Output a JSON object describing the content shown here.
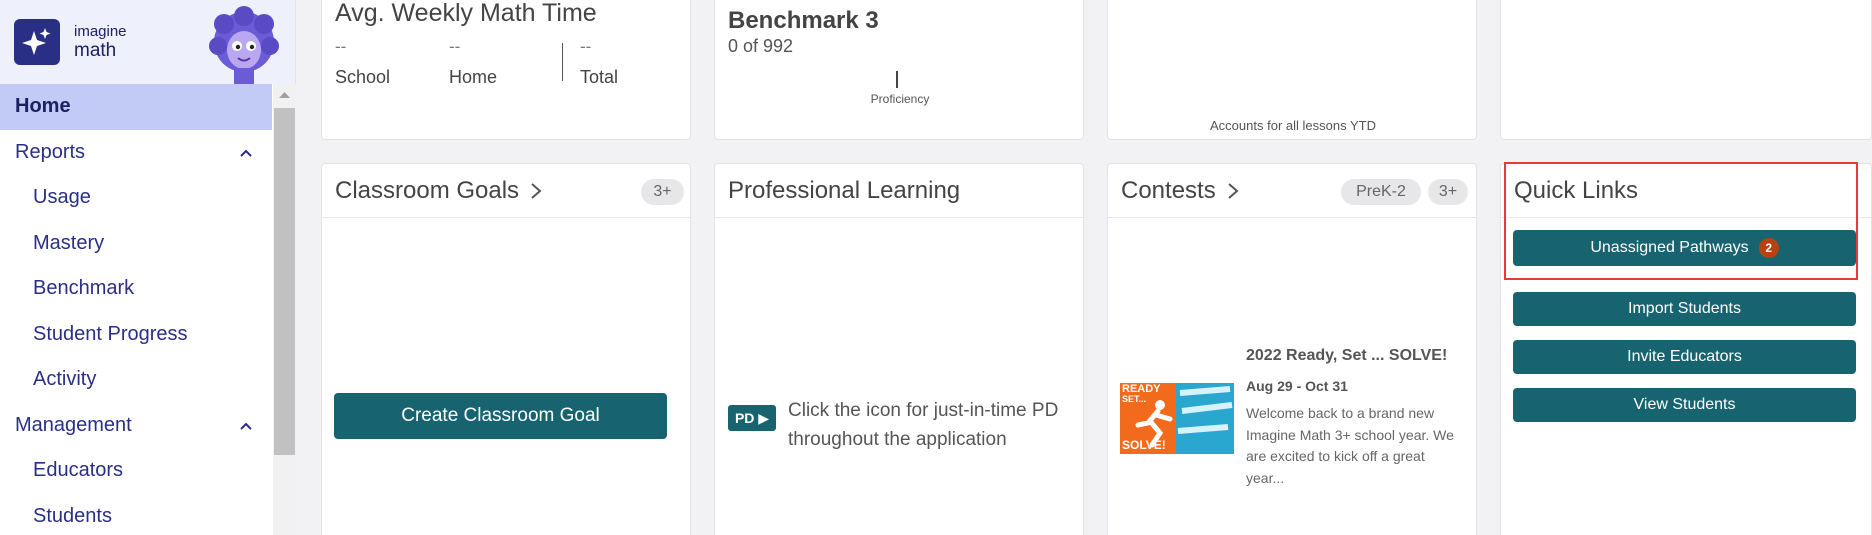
{
  "brand": {
    "line1": "imagine",
    "line2": "math",
    "logo_icon": "sparkle-icon"
  },
  "sidebar": {
    "items": [
      {
        "label": "Home",
        "level": "top",
        "active": true
      },
      {
        "label": "Reports",
        "level": "top",
        "expanded": true
      },
      {
        "label": "Usage",
        "level": "sub"
      },
      {
        "label": "Mastery",
        "level": "sub"
      },
      {
        "label": "Benchmark",
        "level": "sub"
      },
      {
        "label": "Student Progress",
        "level": "sub"
      },
      {
        "label": "Activity",
        "level": "sub"
      },
      {
        "label": "Management",
        "level": "top",
        "expanded": true
      },
      {
        "label": "Educators",
        "level": "sub"
      },
      {
        "label": "Students",
        "level": "sub"
      }
    ]
  },
  "weekly": {
    "title": "Avg. Weekly Math Time",
    "stats": [
      {
        "value": "--",
        "label": "School"
      },
      {
        "value": "--",
        "label": "Home"
      },
      {
        "value": "--",
        "label": "Total"
      }
    ]
  },
  "benchmark": {
    "title": "Benchmark 3",
    "count": "0 of 992",
    "axis_label": "Proficiency"
  },
  "lessons": {
    "footnote": "Accounts for all lessons YTD"
  },
  "classroom_goals": {
    "title": "Classroom Goals",
    "pill": "3+",
    "button": "Create Classroom Goal"
  },
  "professional_learning": {
    "title": "Professional Learning",
    "pd_badge": "PD ▶",
    "text": "Click the icon for just-in-time PD throughout the application"
  },
  "contests": {
    "title": "Contests",
    "pills": [
      "PreK-2",
      "3+"
    ],
    "image_text": {
      "top": "READY",
      "mid": "SET...",
      "bottom": "SOLVE!"
    },
    "headline": "2022 Ready, Set ... SOLVE!",
    "dates": "Aug 29 - Oct 31",
    "body": "Welcome back to a brand new Imagine Math 3+ school year. We are excited to kick off a great year..."
  },
  "quick_links": {
    "title": "Quick Links",
    "buttons": [
      {
        "label": "Unassigned Pathways",
        "badge": "2"
      },
      {
        "label": "Import Students"
      },
      {
        "label": "Invite Educators"
      },
      {
        "label": "View Students"
      }
    ]
  },
  "colors": {
    "teal": "#176470",
    "navy": "#2a2f86",
    "active_bg": "#c1cbf6",
    "badge": "#b8420f",
    "highlight": "#e63a3a"
  }
}
